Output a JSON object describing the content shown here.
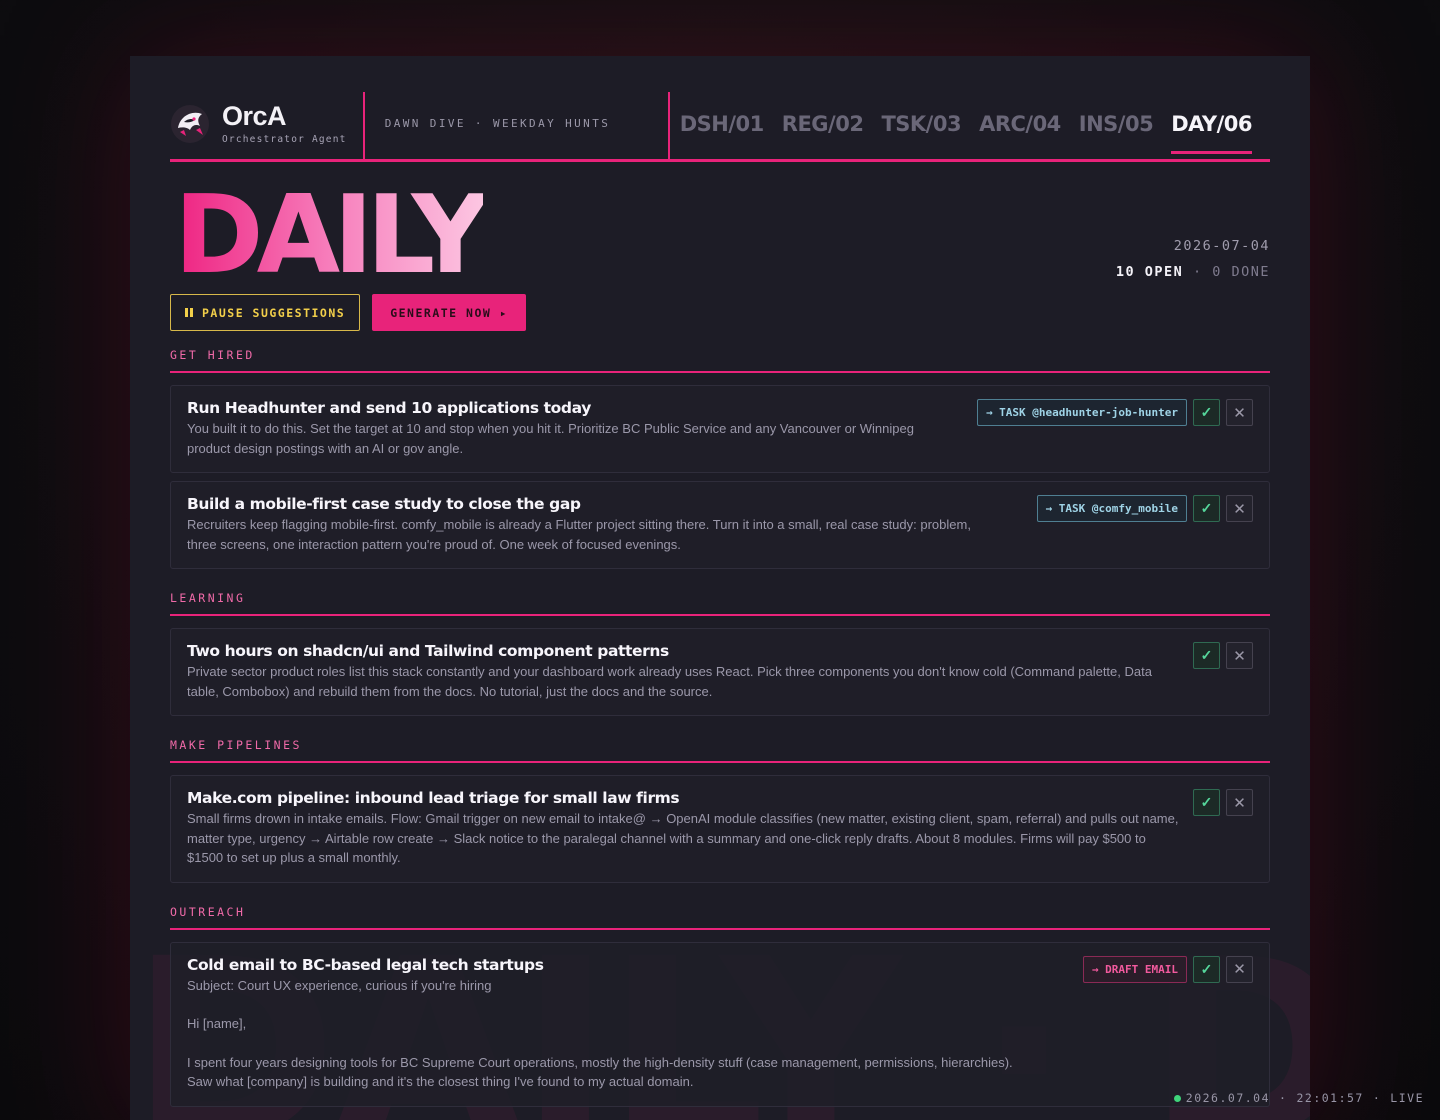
{
  "brand": {
    "name": "OrcA",
    "subtitle": "Orchestrator Agent"
  },
  "header": {
    "tagline": "DAWN DIVE · WEEKDAY HUNTS"
  },
  "tabs": [
    {
      "label": "DSH/01",
      "active": false
    },
    {
      "label": "REG/02",
      "active": false
    },
    {
      "label": "TSK/03",
      "active": false
    },
    {
      "label": "ARC/04",
      "active": false
    },
    {
      "label": "INS/05",
      "active": false
    },
    {
      "label": "DAY/06",
      "active": true
    }
  ],
  "hero": {
    "title": "DAILY",
    "date": "2026-07-04",
    "open_count": "10 OPEN",
    "separator": "·",
    "done_count": "0 DONE",
    "pause_label": "PAUSE SUGGESTIONS",
    "generate_label": "GENERATE NOW ▸"
  },
  "sections": {
    "get_hired": {
      "heading": "GET HIRED",
      "cards": [
        {
          "title": "Run Headhunter and send 10 applications today",
          "body": "You built it to do this. Set the target at 10 and stop when you hit it. Prioritize BC Public Service and any Vancouver or Winnipeg product design postings with an AI or gov angle.",
          "chip": "→ TASK @headhunter-job-hunter"
        },
        {
          "title": "Build a mobile-first case study to close the gap",
          "body": "Recruiters keep flagging mobile-first. comfy_mobile is already a Flutter project sitting there. Turn it into a small, real case study: problem, three screens, one interaction pattern you're proud of. One week of focused evenings.",
          "chip": "→ TASK @comfy_mobile"
        }
      ]
    },
    "learning": {
      "heading": "LEARNING",
      "cards": [
        {
          "title": "Two hours on shadcn/ui and Tailwind component patterns",
          "body": "Private sector product roles list this stack constantly and your dashboard work already uses React. Pick three components you don't know cold (Command palette, Data table, Combobox) and rebuild them from the docs. No tutorial, just the docs and the source."
        }
      ]
    },
    "pipelines": {
      "heading": "MAKE PIPELINES",
      "cards": [
        {
          "title": "Make.com pipeline: inbound lead triage for small law firms",
          "body": "Small firms drown in intake emails. Flow: Gmail trigger on new email to intake@ → OpenAI module classifies (new matter, existing client, spam, referral) and pulls out name, matter type, urgency → Airtable row create → Slack notice to the paralegal channel with a summary and one-click reply drafts. About 8 modules. Firms will pay $500 to $1500 to set up plus a small monthly."
        }
      ]
    },
    "outreach": {
      "heading": "OUTREACH",
      "cards": [
        {
          "title": "Cold email to BC-based legal tech startups",
          "subject": "Subject: Court UX experience, curious if you're hiring",
          "greeting": "Hi [name],",
          "body": "I spent four years designing tools for BC Supreme Court operations, mostly the high-density stuff (case management, permissions, hierarchies). Saw what [company] is building and it's the closest thing I've found to my actual domain.",
          "chip": "→ DRAFT EMAIL"
        }
      ]
    }
  },
  "icons": {
    "check": "✓",
    "dismiss": "✕"
  },
  "watermark": "DAILY · DAY",
  "status": {
    "date": "2026.07.04",
    "sep1": "·",
    "time": "22:01:57",
    "sep2": "·",
    "live": "LIVE"
  },
  "colors": {
    "accent": "#e8237a",
    "yellow": "#f2cf4a",
    "teal": "#9fd3e6",
    "green": "#55d69b"
  }
}
